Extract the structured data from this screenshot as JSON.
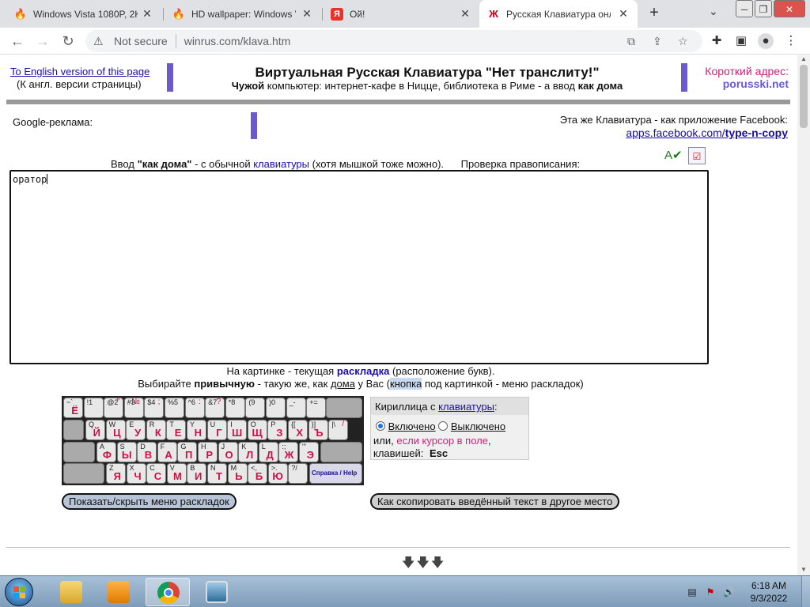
{
  "browser": {
    "tabs": [
      {
        "title": "Windows Vista 1080P, 2K",
        "icon": "flame-icon",
        "active": false
      },
      {
        "title": "HD wallpaper: Windows V",
        "icon": "flame-icon",
        "active": false
      },
      {
        "title": "Ой!",
        "icon": "yandex-icon",
        "active": false
      },
      {
        "title": "Русская Клавиатура онл",
        "icon": "zh-letter-icon",
        "active": true
      }
    ],
    "not_secure": "Not secure",
    "url": "winrus.com/klava.htm",
    "colors": {
      "tabstrip": "#dfe1e5",
      "accent": "#1a73e8"
    }
  },
  "page": {
    "eng_link": "To English version of this page",
    "eng_sub": "(К англ. версии страницы)",
    "title": "Виртуальная Русская Клавиатура \"Нет транслиту!\"",
    "subtitle_bold1": "Чужой",
    "subtitle_mid": " компьютер: интернет-кафе в Ницце, библиотека в Риме - а ввод ",
    "subtitle_bold2": "как дома",
    "short_label": "Короткий адрес:",
    "short_value": "porusski.net",
    "google_ad": "Google-реклама:",
    "fb_label": "Эта же Клавиатура - как приложение Facebook:",
    "fb_link_pre": "apps.facebook.com/",
    "fb_link_bold": "type-n-copy",
    "input_pre": "Ввод ",
    "input_bold": "\"как дома\"",
    "input_mid": " - с обычной ",
    "input_link": "клавиатуры",
    "input_post": " (хотя мышкой тоже можно).",
    "spell_label": "Проверка правописания:",
    "textarea_value": "оратор",
    "layout_line1_pre": "На картинке - текущая ",
    "layout_line1_bold": "раскладка",
    "layout_line1_post": " (расположение букв).",
    "layout_line2_pre": "Выбирайте ",
    "layout_line2_bold": "привычную",
    "layout_line2_mid": " - такую же, как ",
    "layout_line2_link": "дома",
    "layout_line2_mid2": " у Вас (",
    "layout_line2_hl": "кнопка",
    "layout_line2_post": " под картинкой - меню раскладок)",
    "cyr_header_pre": "Кириллица с ",
    "cyr_header_link": "клавиатуры",
    "cyr_header_post": ":",
    "opt_on": "Включено",
    "opt_off": "Выключено",
    "or_text": "или, ",
    "or_pink": "если курсор в поле",
    "or_post": ",",
    "hotkey_pre": "клавишей:",
    "hotkey": "Esc",
    "btn_layouts": "Показать/скрыть меню раскладок",
    "btn_copy": "Как скопировать введённый текст в другое место",
    "more_arrows": "🡇🡇🡇"
  },
  "keyboard": {
    "help": "Справка / Help",
    "rows": [
      [
        [
          "~`",
          "Ё",
          ""
        ],
        [
          "!1",
          "",
          ""
        ],
        [
          "@2",
          "",
          "\""
        ],
        [
          "#3",
          "",
          "№"
        ],
        [
          "$4",
          "",
          ";"
        ],
        [
          "%5",
          "",
          ""
        ],
        [
          "^6",
          "",
          ":"
        ],
        [
          "&7",
          "",
          "?"
        ],
        [
          "*8",
          "",
          ""
        ],
        [
          "(9",
          "",
          ""
        ],
        [
          ")0",
          "",
          ""
        ],
        [
          "_-",
          "",
          ""
        ],
        [
          "+=",
          "",
          ""
        ]
      ],
      [
        [
          "Q",
          "Й",
          ""
        ],
        [
          "W",
          "Ц",
          ""
        ],
        [
          "E",
          "У",
          ""
        ],
        [
          "R",
          "К",
          ""
        ],
        [
          "T",
          "Е",
          ""
        ],
        [
          "Y",
          "Н",
          ""
        ],
        [
          "U",
          "Г",
          ""
        ],
        [
          "I",
          "Ш",
          ""
        ],
        [
          "O",
          "Щ",
          ""
        ],
        [
          "P",
          "З",
          ""
        ],
        [
          "{[",
          "Х",
          ""
        ],
        [
          "}]",
          "Ъ",
          ""
        ],
        [
          "|\\",
          "",
          "/"
        ]
      ],
      [
        [
          "A",
          "Ф",
          ""
        ],
        [
          "S",
          "Ы",
          ""
        ],
        [
          "D",
          "В",
          ""
        ],
        [
          "F",
          "А",
          ""
        ],
        [
          "G",
          "П",
          ""
        ],
        [
          "H",
          "Р",
          ""
        ],
        [
          "J",
          "О",
          ""
        ],
        [
          "K",
          "Л",
          ""
        ],
        [
          "L",
          "Д",
          ""
        ],
        [
          ":;",
          "Ж",
          ""
        ],
        [
          "\"'",
          "Э",
          ""
        ]
      ],
      [
        [
          "Z",
          "Я",
          ""
        ],
        [
          "X",
          "Ч",
          ""
        ],
        [
          "C",
          "С",
          ""
        ],
        [
          "V",
          "М",
          ""
        ],
        [
          "B",
          "И",
          ""
        ],
        [
          "N",
          "Т",
          ""
        ],
        [
          "M",
          "Ь",
          ""
        ],
        [
          "<,",
          "Б",
          ""
        ],
        [
          ">.",
          "Ю",
          ""
        ],
        [
          "?/",
          "",
          ""
        ]
      ]
    ]
  },
  "taskbar": {
    "time": "6:18 AM",
    "date": "9/3/2022"
  }
}
